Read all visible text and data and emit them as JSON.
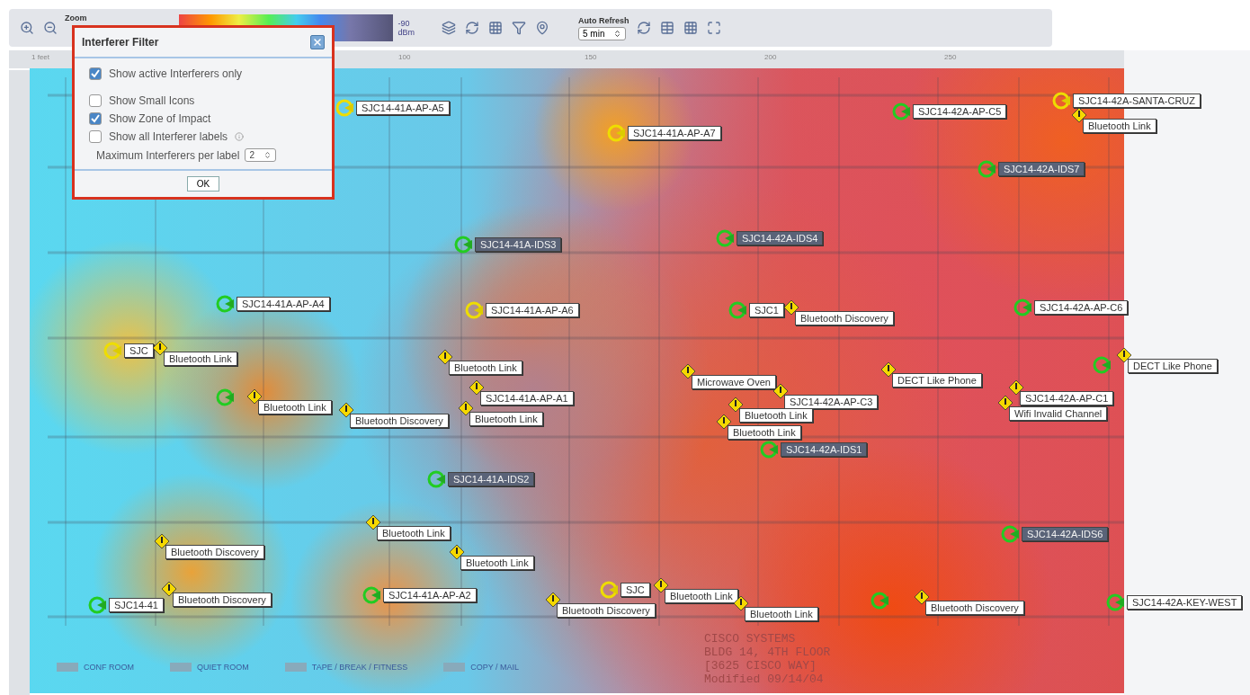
{
  "toolbar": {
    "zoom_label": "Zoom",
    "scale_min": "-90",
    "scale_unit": "dBm",
    "auto_refresh_label": "Auto Refresh",
    "auto_refresh_value": "5 min"
  },
  "ruler": {
    "ticks": [
      "1 feet",
      "100",
      "150",
      "200",
      "250"
    ]
  },
  "dialog": {
    "title": "Interferer Filter",
    "options": [
      {
        "label": "Show active Interferers only",
        "checked": true
      },
      {
        "label": "Show Small Icons",
        "checked": false
      },
      {
        "label": "Show Zone of Impact",
        "checked": true
      },
      {
        "label": "Show all Interferer labels",
        "checked": false,
        "info": true
      }
    ],
    "max_label": "Maximum Interferers per label",
    "max_value": "2",
    "ok": "OK"
  },
  "markers": [
    {
      "kind": "ap-alarm",
      "label": "SJC14-41A-AP-A5"
    },
    {
      "kind": "ap",
      "label": "SJC14-42A-AP-C5"
    },
    {
      "kind": "ap-alarm",
      "label": "SJC14-42A-SANTA-CRUZ"
    },
    {
      "kind": "interferer",
      "label": "Bluetooth Link"
    },
    {
      "kind": "ap-alarm",
      "label": "SJC14-41A-AP-A7"
    },
    {
      "kind": "ids",
      "label": "SJC14-42A-IDS7"
    },
    {
      "kind": "ids",
      "label": "SJC14-42A-IDS4"
    },
    {
      "kind": "ids",
      "label": "SJC14-41A-IDS3"
    },
    {
      "kind": "ap",
      "label": "SJC14-41A-AP-A4"
    },
    {
      "kind": "ap-alarm",
      "label": "SJC14-41A-AP-A6"
    },
    {
      "kind": "ap",
      "label": "SJC1"
    },
    {
      "kind": "interferer",
      "label": "Bluetooth Discovery"
    },
    {
      "kind": "ap",
      "label": "SJC14-42A-AP-C6"
    },
    {
      "kind": "ap-alarm",
      "label": "SJC"
    },
    {
      "kind": "interferer",
      "label": "Bluetooth Link"
    },
    {
      "kind": "interferer",
      "label": "Bluetooth Link"
    },
    {
      "kind": "interferer",
      "label": "Microwave Oven"
    },
    {
      "kind": "interferer",
      "label": "DECT Like Phone"
    },
    {
      "kind": "ap"
    },
    {
      "kind": "interferer",
      "label": "DECT Like Phone"
    },
    {
      "kind": "ap"
    },
    {
      "kind": "interferer",
      "label": "Bluetooth Link"
    },
    {
      "kind": "interferer",
      "label": "Bluetooth Discovery"
    },
    {
      "kind": "interferer",
      "label": "SJC14-41A-AP-A1"
    },
    {
      "kind": "interferer",
      "label": "Bluetooth Link"
    },
    {
      "kind": "interferer",
      "label": "SJC14-42A-AP-C3"
    },
    {
      "kind": "interferer",
      "label": "Bluetooth Link"
    },
    {
      "kind": "interferer",
      "label": "Bluetooth Link"
    },
    {
      "kind": "interferer",
      "label": "SJC14-42A-AP-C1"
    },
    {
      "kind": "interferer",
      "label": "Wifi Invalid Channel"
    },
    {
      "kind": "ids",
      "label": "SJC14-42A-IDS1"
    },
    {
      "kind": "ids",
      "label": "SJC14-41A-IDS2"
    },
    {
      "kind": "interferer",
      "label": "Bluetooth Link"
    },
    {
      "kind": "interferer",
      "label": "Bluetooth Discovery"
    },
    {
      "kind": "interferer",
      "label": "Bluetooth Link"
    },
    {
      "kind": "ids",
      "label": "SJC14-42A-IDS6"
    },
    {
      "kind": "ap",
      "label": "SJC14-41A-AP-A2"
    },
    {
      "kind": "ap",
      "label": "SJC14-41"
    },
    {
      "kind": "interferer",
      "label": "Bluetooth Discovery"
    },
    {
      "kind": "ap-alarm",
      "label": "SJC"
    },
    {
      "kind": "interferer",
      "label": "Bluetooth Discovery"
    },
    {
      "kind": "interferer",
      "label": "Bluetooth Link"
    },
    {
      "kind": "interferer",
      "label": "Bluetooth Link"
    },
    {
      "kind": "ap"
    },
    {
      "kind": "interferer",
      "label": "Bluetooth Discovery"
    },
    {
      "kind": "ap",
      "label": "SJC14-42A-KEY-WEST"
    }
  ],
  "legend": [
    "CONF ROOM",
    "QUIET ROOM",
    "TAPE / BREAK / FITNESS",
    "COPY / MAIL"
  ],
  "title_block": [
    "CISCO SYSTEMS",
    "BLDG 14, 4TH FLOOR",
    "[3625 CISCO WAY]",
    "Modified 09/14/04"
  ]
}
